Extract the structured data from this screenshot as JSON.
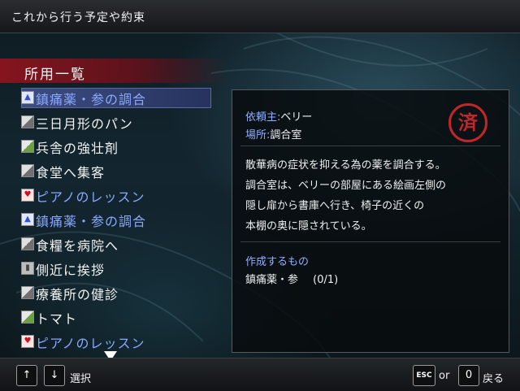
{
  "header": {
    "title": "これから行う予定や約束"
  },
  "section": {
    "title": "所用一覧"
  },
  "list": {
    "items": [
      {
        "label": "鎮痛薬・参の調合",
        "icon": "potion-icon",
        "color": "blue",
        "selected": true
      },
      {
        "label": "三日月形のパン",
        "icon": "book-icon",
        "color": "white"
      },
      {
        "label": "兵舎の強壮剤",
        "icon": "herb-icon",
        "color": "white"
      },
      {
        "label": "食堂へ集客",
        "icon": "book-icon",
        "color": "white"
      },
      {
        "label": "ピアノのレッスン",
        "icon": "heart-icon",
        "color": "blue"
      },
      {
        "label": "鎮痛薬・参の調合",
        "icon": "potion-icon",
        "color": "blue"
      },
      {
        "label": "食糧を病院へ",
        "icon": "book-icon",
        "color": "white"
      },
      {
        "label": "側近に挨拶",
        "icon": "door-icon",
        "color": "white"
      },
      {
        "label": "療養所の健診",
        "icon": "book-icon",
        "color": "white"
      },
      {
        "label": "トマト",
        "icon": "herb-icon",
        "color": "white"
      },
      {
        "label": "ピアノのレッスン",
        "icon": "heart-icon",
        "color": "blue"
      }
    ]
  },
  "detail": {
    "client_label": "依頼主:",
    "client_value": "ベリー",
    "place_label": "場所:",
    "place_value": "調合室",
    "seal_text": "済",
    "description": [
      "散華病の症状を抑える為の薬を調合する。",
      "調合室は、ベリーの部屋にある絵画左側の",
      "隠し扉から書庫へ行き、椅子の近くの",
      "本棚の奥に隠されている。"
    ],
    "make_title": "作成するもの",
    "make_item": "鎮痛薬・参",
    "make_count": "(0/1)"
  },
  "footer": {
    "up_key": "↑",
    "down_key": "↓",
    "select_label": "選択",
    "esc_key": "ESC",
    "or_label": "or",
    "zero_key": "0",
    "back_label": "戻る"
  },
  "colors": {
    "accent_red": "#c0262a",
    "selected_bg": "#3c4d80",
    "blue_text": "#8fb0ff"
  }
}
